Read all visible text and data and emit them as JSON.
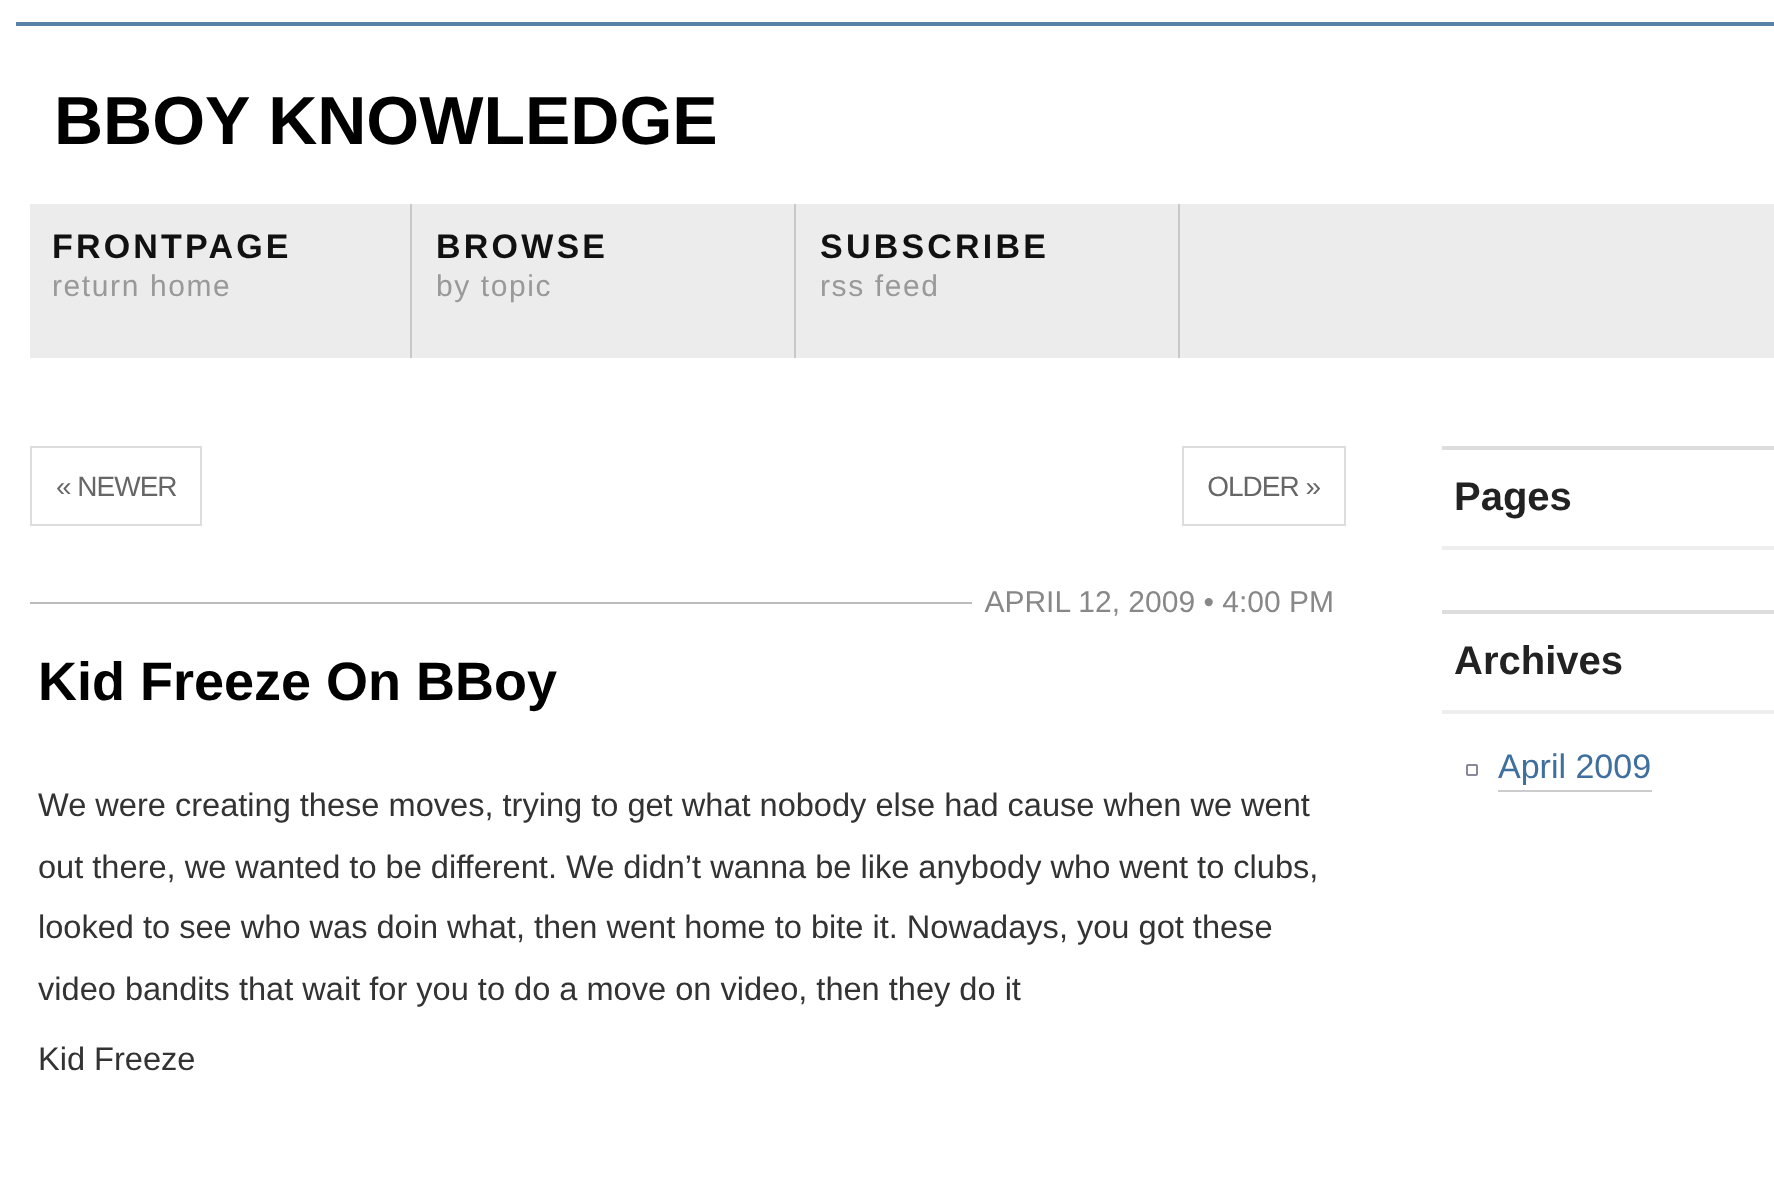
{
  "site_title": "BBOY KNOWLEDGE",
  "nav": [
    {
      "label": "FRONTPAGE",
      "sub": "return home"
    },
    {
      "label": "BROWSE",
      "sub": "by topic"
    },
    {
      "label": "SUBSCRIBE",
      "sub": "rss feed"
    }
  ],
  "pager": {
    "newer": "« NEWER",
    "older": "OLDER »"
  },
  "post": {
    "date": "APRIL 12, 2009 • 4:00 PM",
    "title": "Kid Freeze On BBoy",
    "paragraphs": [
      "We were creating these moves, trying to get what nobody else had cause when we went out there, we wanted to be different. We didn’t wanna be like anybody who went to clubs, looked to see who was doin what, then went home to bite it. Nowadays, you got these video bandits that wait for you to do a move on video, then they do it",
      "Kid Freeze"
    ]
  },
  "sidebar": [
    {
      "heading": "Pages"
    },
    {
      "heading": "Archives",
      "links": [
        "April 2009"
      ]
    }
  ]
}
